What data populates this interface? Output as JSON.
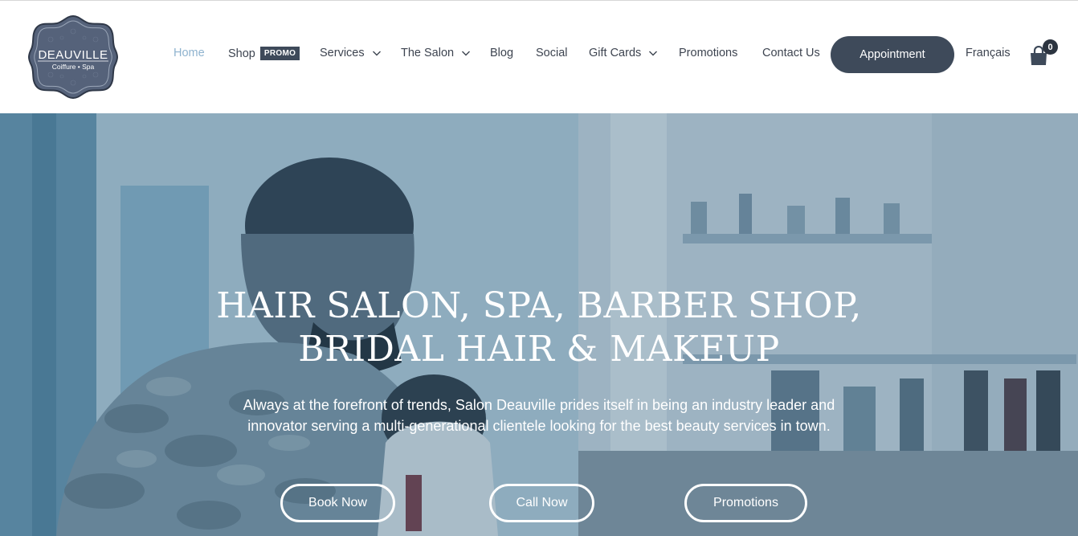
{
  "logo": {
    "name": "DEAUVILLE",
    "tagline": "Coiffure • Spa"
  },
  "nav": {
    "home": "Home",
    "shop": "Shop",
    "shop_badge": "PROMO",
    "services": "Services",
    "salon": "The Salon",
    "blog": "Blog",
    "social": "Social",
    "gift_cards": "Gift Cards",
    "promotions": "Promotions",
    "contact": "Contact Us",
    "appointment": "Appointment",
    "language": "Français",
    "cart_count": "0"
  },
  "icons": {
    "cart": "shopping-bag-icon",
    "dropdown": "chevron-down-icon"
  },
  "colors": {
    "accent": "#3e4a5a",
    "active_link": "#8fb3cf",
    "text": "#3d4450"
  },
  "hero": {
    "title_line1": "HAIR SALON, SPA, BARBER SHOP,",
    "title_line2": "BRIDAL HAIR & MAKEUP",
    "subtitle_line1": "Always at the forefront of trends, Salon Deauville prides itself in being an industry leader and",
    "subtitle_line2": "innovator serving a multi-generational clientele looking for the best beauty services in town.",
    "buttons": {
      "book": "Book Now",
      "call": "Call Now",
      "promotions": "Promotions"
    }
  }
}
